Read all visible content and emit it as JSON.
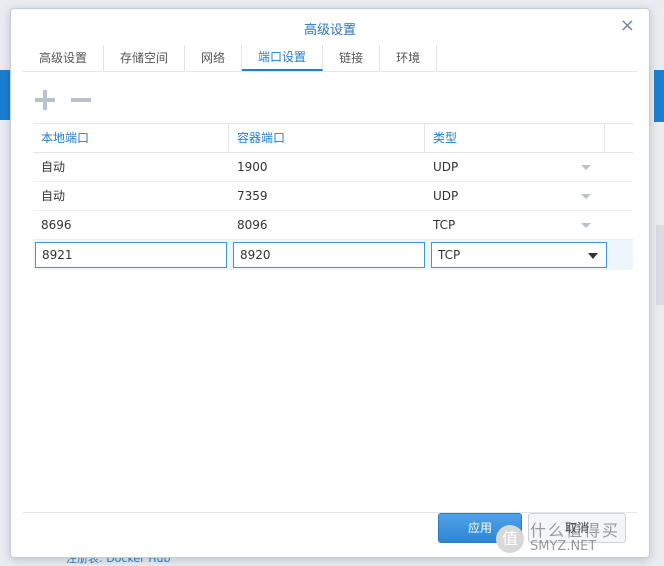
{
  "background": {
    "bottom_text": "注册表: Docker Hub"
  },
  "dialog": {
    "title": "高级设置",
    "close_glyph": "×"
  },
  "tabs": [
    {
      "label": "高级设置",
      "active": false
    },
    {
      "label": "存储空间",
      "active": false
    },
    {
      "label": "网络",
      "active": false
    },
    {
      "label": "端口设置",
      "active": true
    },
    {
      "label": "链接",
      "active": false
    },
    {
      "label": "环境",
      "active": false
    }
  ],
  "toolbar": {
    "add_icon": "plus-icon",
    "remove_icon": "minus-icon"
  },
  "table": {
    "headers": [
      "本地端口",
      "容器端口",
      "类型"
    ],
    "rows": [
      {
        "local": "自动",
        "container": "1900",
        "type": "UDP"
      },
      {
        "local": "自动",
        "container": "7359",
        "type": "UDP"
      },
      {
        "local": "8696",
        "container": "8096",
        "type": "TCP"
      }
    ],
    "edit_row": {
      "local": "8921",
      "container": "8920",
      "type": "TCP"
    }
  },
  "footer": {
    "apply_label": "应用",
    "cancel_label": "取消"
  },
  "watermark": {
    "logo_char": "值",
    "top": "什么值得买",
    "bottom": "SMYZ.NET"
  },
  "colors": {
    "accent": "#1c7fd0",
    "apply_button": "#2d85d2"
  }
}
